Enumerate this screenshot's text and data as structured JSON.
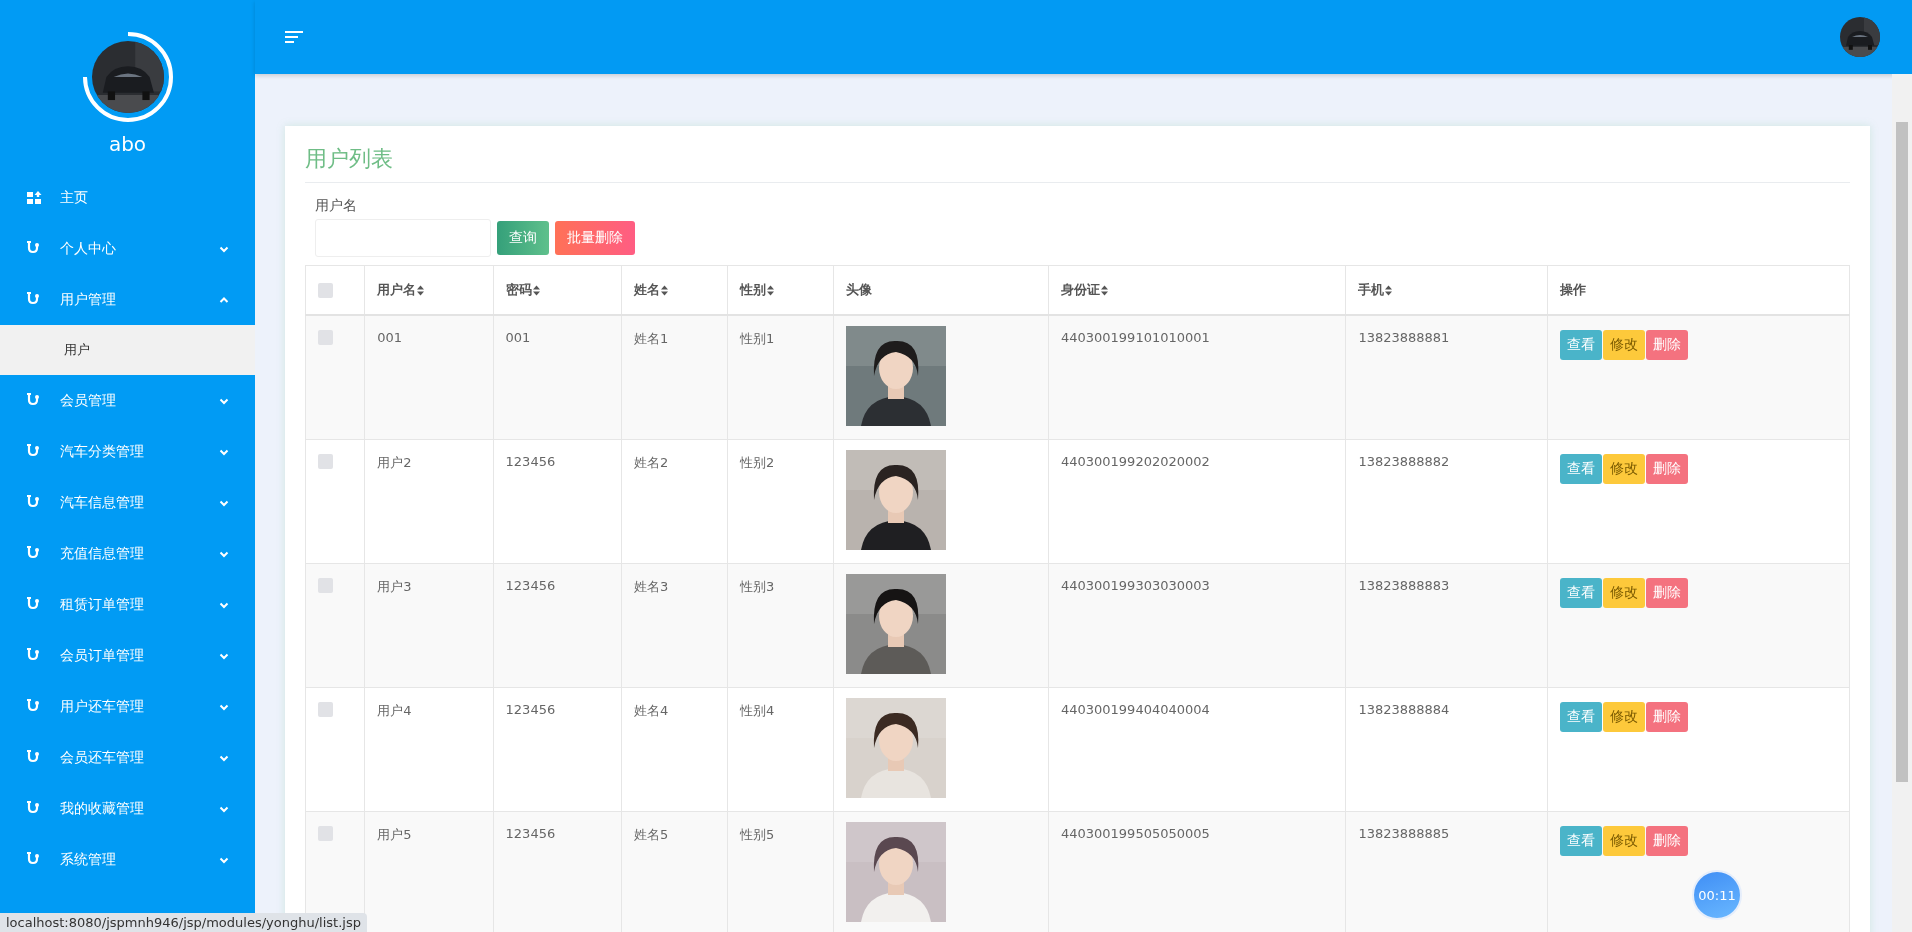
{
  "sidebar": {
    "user_name": "abo",
    "menu": [
      {
        "label": "主页",
        "kind": "home"
      },
      {
        "label": "个人中心",
        "kind": "group",
        "expanded": false
      },
      {
        "label": "用户管理",
        "kind": "group",
        "expanded": true,
        "children": [
          {
            "label": "用户",
            "selected": true
          }
        ]
      },
      {
        "label": "会员管理",
        "kind": "group",
        "expanded": false
      },
      {
        "label": "汽车分类管理",
        "kind": "group",
        "expanded": false
      },
      {
        "label": "汽车信息管理",
        "kind": "group",
        "expanded": false
      },
      {
        "label": "充值信息管理",
        "kind": "group",
        "expanded": false
      },
      {
        "label": "租赁订单管理",
        "kind": "group",
        "expanded": false
      },
      {
        "label": "会员订单管理",
        "kind": "group",
        "expanded": false
      },
      {
        "label": "用户还车管理",
        "kind": "group",
        "expanded": false
      },
      {
        "label": "会员还车管理",
        "kind": "group",
        "expanded": false
      },
      {
        "label": "我的收藏管理",
        "kind": "group",
        "expanded": false
      },
      {
        "label": "系统管理",
        "kind": "group",
        "expanded": false
      }
    ]
  },
  "page": {
    "title": "用户列表",
    "search": {
      "label": "用户名"
    },
    "buttons": [
      {
        "label": "查询",
        "kind": "query"
      },
      {
        "label": "批量删除",
        "kind": "delete"
      }
    ]
  },
  "table": {
    "select_all": {
      "checked": false
    },
    "columns": [
      {
        "label": "用户名",
        "sortable": true
      },
      {
        "label": "密码",
        "sortable": true
      },
      {
        "label": "姓名",
        "sortable": true
      },
      {
        "label": "性别",
        "sortable": true
      },
      {
        "label": "头像",
        "sortable": false
      },
      {
        "label": "身份证",
        "sortable": true
      },
      {
        "label": "手机",
        "sortable": true
      },
      {
        "label": "操作",
        "sortable": false
      }
    ],
    "rows": [
      {
        "checked": false,
        "username": "001",
        "password": "001",
        "name": "姓名1",
        "gender": "性别1",
        "id_card": "440300199101010001",
        "phone": "13823888881",
        "actions": [
          {
            "label": "查看",
            "kind": "view"
          },
          {
            "label": "修改",
            "kind": "edit"
          },
          {
            "label": "删除",
            "kind": "delete"
          }
        ]
      },
      {
        "checked": false,
        "username": "用户2",
        "password": "123456",
        "name": "姓名2",
        "gender": "性别2",
        "id_card": "440300199202020002",
        "phone": "13823888882",
        "actions": [
          {
            "label": "查看",
            "kind": "view"
          },
          {
            "label": "修改",
            "kind": "edit"
          },
          {
            "label": "删除",
            "kind": "delete"
          }
        ]
      },
      {
        "checked": false,
        "username": "用户3",
        "password": "123456",
        "name": "姓名3",
        "gender": "性别3",
        "id_card": "440300199303030003",
        "phone": "13823888883",
        "actions": [
          {
            "label": "查看",
            "kind": "view"
          },
          {
            "label": "修改",
            "kind": "edit"
          },
          {
            "label": "删除",
            "kind": "delete"
          }
        ]
      },
      {
        "checked": false,
        "username": "用户4",
        "password": "123456",
        "name": "姓名4",
        "gender": "性别4",
        "id_card": "440300199404040004",
        "phone": "13823888884",
        "actions": [
          {
            "label": "查看",
            "kind": "view"
          },
          {
            "label": "修改",
            "kind": "edit"
          },
          {
            "label": "删除",
            "kind": "delete"
          }
        ]
      },
      {
        "checked": false,
        "username": "用户5",
        "password": "123456",
        "name": "姓名5",
        "gender": "性别5",
        "id_card": "440300199505050005",
        "phone": "13823888885",
        "actions": [
          {
            "label": "查看",
            "kind": "view"
          },
          {
            "label": "修改",
            "kind": "edit"
          },
          {
            "label": "删除",
            "kind": "delete"
          }
        ]
      }
    ]
  },
  "status_url": "localhost:8080/jspmnh946/jsp/modules/yonghu/list.jsp",
  "timer": "00:11"
}
